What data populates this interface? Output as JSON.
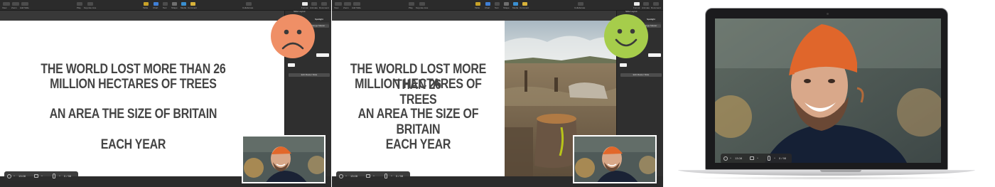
{
  "toolbar": {
    "left_items": [
      "View",
      "Zoom",
      "Add Slide"
    ],
    "center_items": [
      "Play",
      "Keynote Live"
    ],
    "insert_items": [
      "Table",
      "Chart",
      "Text",
      "Shape",
      "Media",
      "Comment"
    ],
    "collaborate": "Collaborate",
    "right_items": [
      "Format",
      "Animate",
      "Document"
    ]
  },
  "sidebar": {
    "title": "Slide Layout",
    "tab": "Spotlight",
    "button_edit": "Edit Master Slide",
    "button_change": "Change Master"
  },
  "slide": {
    "line1": "THE WORLD LOST MORE THAN 26",
    "line2": "MILLION HECTARES OF TREES",
    "line3": "AN AREA THE SIZE OF BRITAIN",
    "line4": "EACH YEAR"
  },
  "zoom_control": {
    "time": "13.08",
    "count": "0 / 98"
  },
  "faces": {
    "before": "sad-face-icon",
    "after": "happy-face-icon",
    "before_color": "#ef8f66",
    "after_color": "#a6cd4b"
  }
}
